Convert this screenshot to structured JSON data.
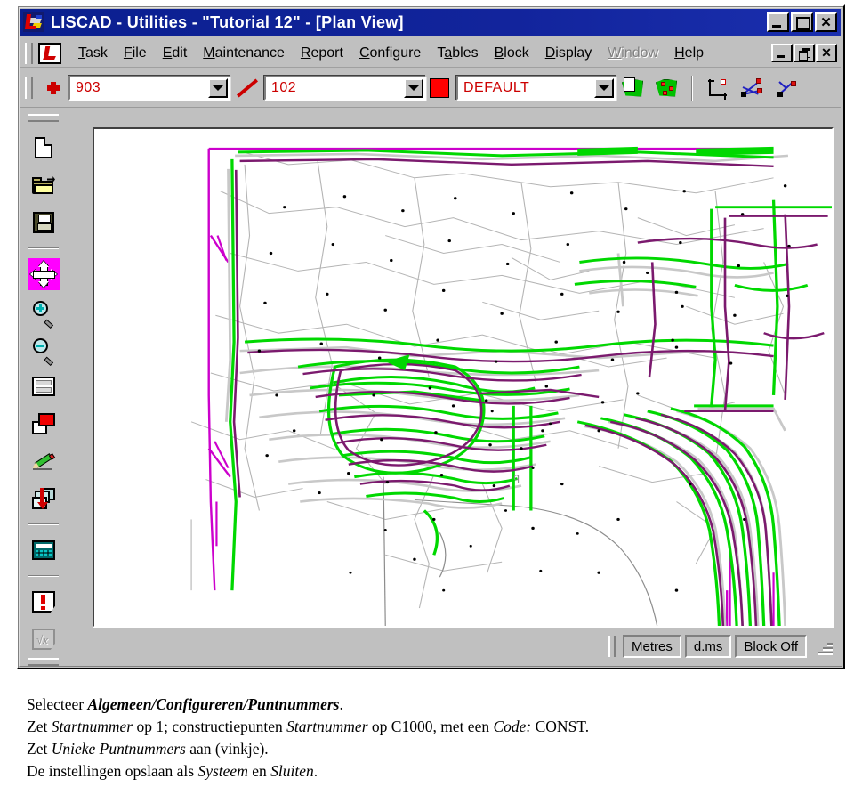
{
  "window": {
    "title": "LISCAD  -  Utilities  -  \"Tutorial 12\"  -  [Plan View]",
    "logo_icon": "liscad-logo-icon",
    "controls": [
      {
        "name": "minimize",
        "label": "_",
        "icon": "minimize-icon"
      },
      {
        "name": "maximize",
        "label": "□",
        "icon": "maximize-icon"
      },
      {
        "name": "close",
        "label": "✕",
        "icon": "close-icon"
      }
    ]
  },
  "menu": {
    "logo_icon": "liscad-menu-logo-icon",
    "items": [
      {
        "label": "Task",
        "accel": "T",
        "pre": "",
        "post": "ask",
        "disabled": false
      },
      {
        "label": "File",
        "accel": "F",
        "pre": "",
        "post": "ile",
        "disabled": false
      },
      {
        "label": "Edit",
        "accel": "E",
        "pre": "",
        "post": "dit",
        "disabled": false
      },
      {
        "label": "Maintenance",
        "accel": "M",
        "pre": "",
        "post": "aintenance",
        "disabled": false
      },
      {
        "label": "Report",
        "accel": "R",
        "pre": "",
        "post": "eport",
        "disabled": false
      },
      {
        "label": "Configure",
        "accel": "C",
        "pre": "",
        "post": "onfigure",
        "disabled": false
      },
      {
        "label": "Tables",
        "accel": "a",
        "pre": "T",
        "post": "bles",
        "disabled": false
      },
      {
        "label": "Block",
        "accel": "B",
        "pre": "",
        "post": "lock",
        "disabled": false
      },
      {
        "label": "Display",
        "accel": "D",
        "pre": "",
        "post": "isplay",
        "disabled": false
      },
      {
        "label": "Window",
        "accel": "W",
        "pre": "",
        "post": "indow",
        "disabled": true
      },
      {
        "label": "Help",
        "accel": "H",
        "pre": "",
        "post": "elp",
        "disabled": false
      }
    ],
    "mdi_controls": [
      {
        "name": "mdi-minimize",
        "icon": "minimize-icon"
      },
      {
        "name": "mdi-restore",
        "icon": "restore-icon"
      },
      {
        "name": "mdi-close",
        "label": "✕",
        "icon": "close-icon"
      }
    ]
  },
  "toolbar": {
    "point_icon": "point-marker-icon",
    "point_combo_value": "903",
    "line_icon": "line-style-icon",
    "line_combo_value": "102",
    "color_swatch": "#ff0000",
    "layer_combo_value": "DEFAULT",
    "dropdown_icon": "chevron-down-icon",
    "buttons": [
      {
        "name": "create-polygon-face-button",
        "icon": "polygon-face-icon"
      },
      {
        "name": "polygon-points-button",
        "icon": "polygon-points-icon"
      },
      {
        "name": "coordinate-axes-button",
        "icon": "coordinate-axes-icon"
      },
      {
        "name": "vector-network-button",
        "icon": "vector-network-icon"
      },
      {
        "name": "vector-single-button",
        "icon": "vector-single-icon"
      }
    ]
  },
  "sidebar": {
    "items": [
      {
        "name": "new-file",
        "icon": "new-file-icon",
        "active": false
      },
      {
        "name": "open-file",
        "icon": "open-folder-icon",
        "active": false
      },
      {
        "name": "save-file",
        "icon": "floppy-save-icon",
        "active": false
      },
      {
        "name": "pan",
        "icon": "pan-move-icon",
        "active": true
      },
      {
        "name": "zoom-in",
        "icon": "zoom-in-icon",
        "active": false
      },
      {
        "name": "zoom-out",
        "icon": "zoom-out-icon",
        "active": false
      },
      {
        "name": "zoom-window",
        "icon": "zoom-window-icon",
        "active": false
      },
      {
        "name": "redraw",
        "icon": "red-page-icon",
        "active": false
      },
      {
        "name": "draw-pencil",
        "icon": "green-pencil-icon",
        "active": false
      },
      {
        "name": "layers",
        "icon": "layers-refresh-icon",
        "active": false
      },
      {
        "name": "calculator",
        "icon": "calculator-icon",
        "active": false
      },
      {
        "name": "warnings",
        "icon": "warning-page-icon",
        "active": false
      },
      {
        "name": "formula",
        "icon": "formula-page-icon",
        "active": false,
        "disabled": true
      }
    ]
  },
  "status_bar": {
    "panes": [
      {
        "name": "units",
        "label": "Metres"
      },
      {
        "name": "angle-format",
        "label": "d.ms"
      },
      {
        "name": "block-state",
        "label": "Block Off"
      }
    ],
    "resize_grip_icon": "resize-grip-icon"
  },
  "plan_view": {
    "description": "Contour plan view of a survey site with green, purple and grey contour lines and black survey point markers",
    "colors": {
      "contour_major": "#7b1a6e",
      "contour_index": "#00d000",
      "contour_minor": "#b0b0b0",
      "boundary": "#cc00cc",
      "point": "#000000",
      "background": "#ffffff"
    }
  },
  "caption": {
    "lines": [
      [
        {
          "t": "Selecteer ",
          "s": "n"
        },
        {
          "t": "Algemeen/Configureren/Puntnummers",
          "s": "bi"
        },
        {
          "t": ".",
          "s": "n"
        }
      ],
      [
        {
          "t": "Zet ",
          "s": "n"
        },
        {
          "t": "Startnummer",
          "s": "i"
        },
        {
          "t": " op 1; constructiepunten ",
          "s": "n"
        },
        {
          "t": "Startnummer",
          "s": "i"
        },
        {
          "t": " op C1000, met een ",
          "s": "n"
        },
        {
          "t": "Code:",
          "s": "i"
        },
        {
          "t": " CONST.",
          "s": "n"
        }
      ],
      [
        {
          "t": "Zet ",
          "s": "n"
        },
        {
          "t": "Unieke Puntnummers",
          "s": "i"
        },
        {
          "t": " aan (vinkje).",
          "s": "n"
        }
      ],
      [
        {
          "t": "De instellingen opslaan als ",
          "s": "n"
        },
        {
          "t": "Systeem",
          "s": "i"
        },
        {
          "t": " en ",
          "s": "n"
        },
        {
          "t": "Sluiten",
          "s": "i"
        },
        {
          "t": ".",
          "s": "n"
        }
      ]
    ]
  }
}
